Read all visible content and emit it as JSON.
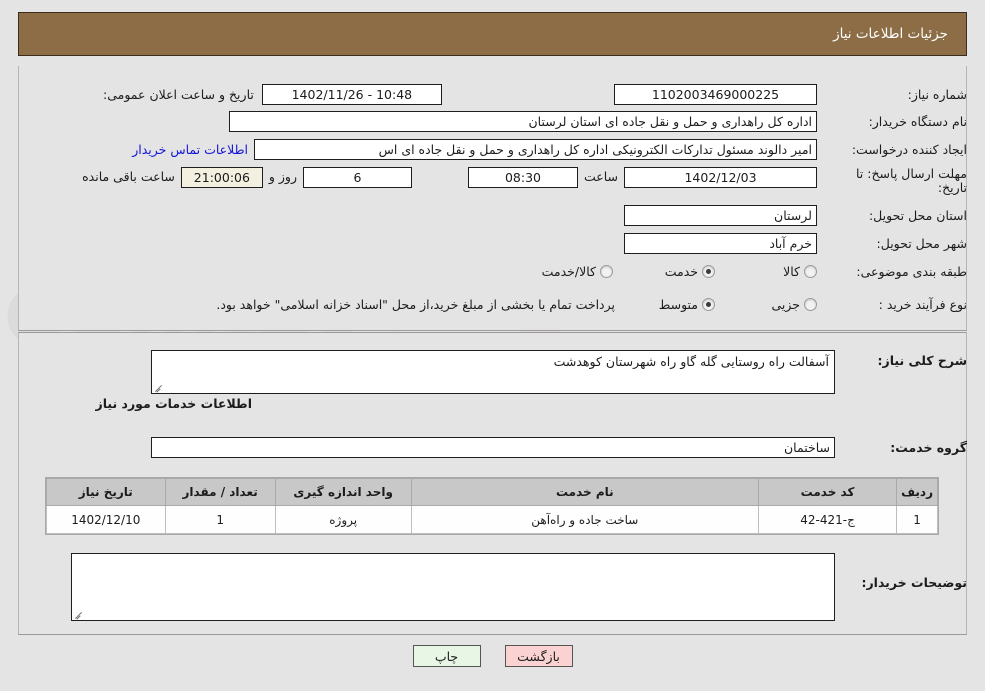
{
  "header": {
    "title": "جزئیات اطلاعات نیاز"
  },
  "form": {
    "need_number": {
      "label": "شماره نیاز:",
      "value": "1102003469000225"
    },
    "announce_datetime": {
      "label": "تاریخ و ساعت اعلان عمومی:",
      "value": "10:48 - 1402/11/26"
    },
    "buyer_org": {
      "label": "نام دستگاه خریدار:",
      "value": "اداره کل راهداری و حمل و نقل جاده ای استان لرستان"
    },
    "request_creator": {
      "label": "ایجاد کننده درخواست:",
      "value": "امیر دالوند مسئول تدارکات الکترونیکی  اداره کل راهداری و حمل و نقل جاده ای اس",
      "contact_link": "اطلاعات تماس خریدار"
    },
    "response_deadline": {
      "label_line1": "مهلت ارسال پاسخ: تا",
      "label_line2": "تاریخ:",
      "date": "1402/12/03",
      "time_label": "ساعت",
      "time": "08:30",
      "days": "6",
      "days_label": "روز و",
      "countdown": "21:00:06",
      "countdown_suffix": "ساعت باقی مانده"
    },
    "delivery_province": {
      "label": "استان محل تحویل:",
      "value": "لرستان"
    },
    "delivery_city": {
      "label": "شهر محل تحویل:",
      "value": "خرم آباد"
    },
    "subject_category": {
      "label": "طبقه بندی موضوعی:",
      "options": [
        {
          "label": "کالا",
          "selected": false
        },
        {
          "label": "خدمت",
          "selected": true
        },
        {
          "label": "کالا/خدمت",
          "selected": false
        }
      ]
    },
    "purchase_process": {
      "label": "نوع فرآیند خرید :",
      "options": [
        {
          "label": "جزیی",
          "selected": false
        },
        {
          "label": "متوسط",
          "selected": true
        }
      ],
      "note": "پرداخت تمام یا بخشی از مبلغ خرید،از محل \"اسناد خزانه اسلامی\" خواهد بود."
    }
  },
  "details": {
    "general_description": {
      "label": "شرح کلی نیاز:",
      "value": "آسفالت راه روستایی گله گاو راه شهرستان کوهدشت"
    },
    "services_section_title": "اطلاعات خدمات مورد نیاز",
    "service_group": {
      "label": "گروه خدمت:",
      "value": "ساختمان"
    },
    "buyer_comments": {
      "label": "توضیحات خریدار:",
      "value": ""
    }
  },
  "table": {
    "columns": [
      "ردیف",
      "کد خدمت",
      "نام خدمت",
      "واحد اندازه گیری",
      "تعداد / مقدار",
      "تاریخ نیاز"
    ],
    "rows": [
      {
        "index": "1",
        "service_code": "ج-421-42",
        "service_name": "ساخت جاده و راه‌آهن",
        "unit": "پروژه",
        "quantity": "1",
        "need_date": "1402/12/10"
      }
    ]
  },
  "footer": {
    "print_button": "چاپ",
    "back_button": "بازگشت"
  },
  "colors": {
    "header_bg": "#8c6d45",
    "link": "#1414d8",
    "countdown_bg": "#f3f0e0",
    "print_btn_bg": "#e8f6e6",
    "back_btn_bg": "#fbd2d2",
    "table_header_bg": "#c8c8c8"
  },
  "watermark": {
    "text": "AriaTender.net"
  }
}
